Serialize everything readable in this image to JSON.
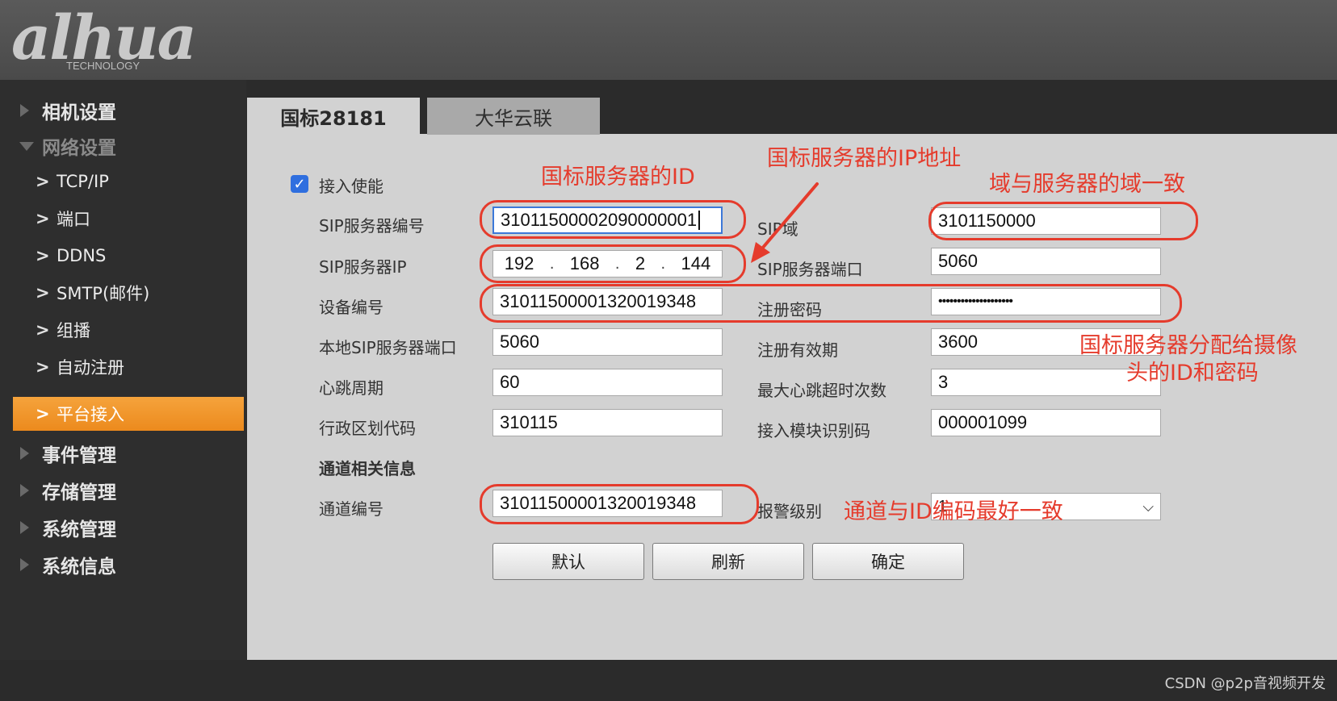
{
  "brand": {
    "logo_text": "alhua",
    "logo_sub": "TECHNOLOGY"
  },
  "sidebar": {
    "items": [
      {
        "label": "相机设置",
        "type": "top"
      },
      {
        "label": "网络设置",
        "type": "top-open"
      },
      {
        "label": "TCP/IP",
        "type": "sub"
      },
      {
        "label": "端口",
        "type": "sub"
      },
      {
        "label": "DDNS",
        "type": "sub"
      },
      {
        "label": "SMTP(邮件)",
        "type": "sub"
      },
      {
        "label": "组播",
        "type": "sub"
      },
      {
        "label": "自动注册",
        "type": "sub"
      },
      {
        "label": "平台接入",
        "type": "sub-active"
      },
      {
        "label": "事件管理",
        "type": "top"
      },
      {
        "label": "存储管理",
        "type": "top"
      },
      {
        "label": "系统管理",
        "type": "top"
      },
      {
        "label": "系统信息",
        "type": "top"
      }
    ],
    "chevron": ">",
    "active_color": "#f09028"
  },
  "tabs": [
    {
      "label": "国标28181",
      "active": true
    },
    {
      "label": "大华云联",
      "active": false
    }
  ],
  "form": {
    "enable": {
      "label": "接入使能",
      "checked": true,
      "check_glyph": "✓"
    },
    "sip_server_id": {
      "label": "SIP服务器编号",
      "value": "31011500002090000001"
    },
    "sip_domain": {
      "label": "SIP域",
      "value": "3101150000"
    },
    "sip_server_ip": {
      "label": "SIP服务器IP",
      "octets": [
        "192",
        "168",
        "2",
        "144"
      ],
      "dot": "."
    },
    "sip_server_port": {
      "label": "SIP服务器端口",
      "value": "5060"
    },
    "device_id": {
      "label": "设备编号",
      "value": "31011500001320019348"
    },
    "register_password": {
      "label": "注册密码",
      "value": "••••••••••••••••••••"
    },
    "local_sip_port": {
      "label": "本地SIP服务器端口",
      "value": "5060"
    },
    "register_validity": {
      "label": "注册有效期",
      "value": "3600"
    },
    "heartbeat_period": {
      "label": "心跳周期",
      "value": "60"
    },
    "max_heartbeat_timeouts": {
      "label": "最大心跳超时次数",
      "value": "3"
    },
    "region_code": {
      "label": "行政区划代码",
      "value": "310115"
    },
    "module_id": {
      "label": "接入模块识别码",
      "value": "000001099"
    },
    "channel_section": {
      "label": "通道相关信息"
    },
    "channel_id": {
      "label": "通道编号",
      "value": "31011500001320019348"
    },
    "alarm_level": {
      "label": "报警级别",
      "value": "1",
      "arrow": "⌵"
    }
  },
  "buttons": {
    "default": "默认",
    "refresh": "刷新",
    "ok": "确定"
  },
  "annotations": {
    "server_id": "国标服务器的ID",
    "server_ip": "国标服务器的IP地址",
    "domain": "域与服务器的域一致",
    "assigned_1": "国标服务器分配给摄像",
    "assigned_2": "头的ID和密码",
    "channel": "通道与ID编码最好一致",
    "color": "#e53b2c"
  },
  "watermark": "CSDN @p2p音视频开发"
}
